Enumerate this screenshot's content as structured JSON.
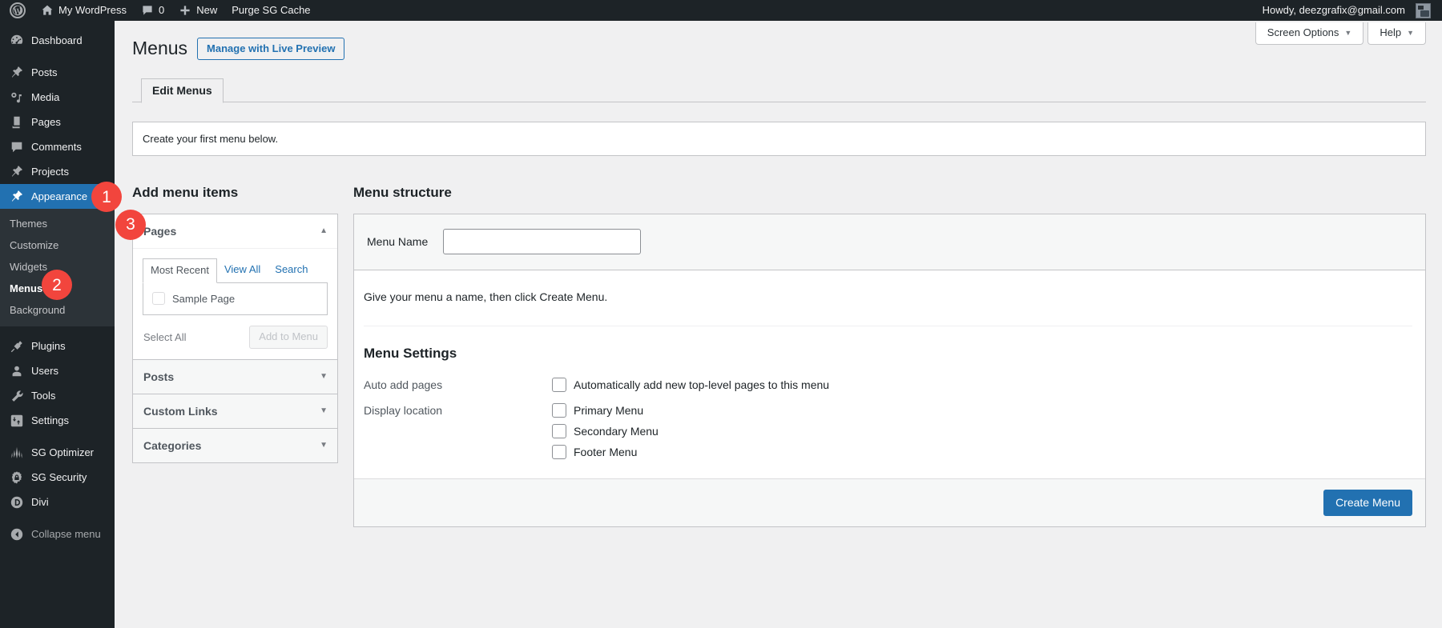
{
  "adminbar": {
    "logo_icon": "wordpress-logo-icon",
    "site_name": "My WordPress",
    "home_icon": "home-icon",
    "comments_icon": "comment-bubble-icon",
    "comment_count": "0",
    "new_icon": "plus-icon",
    "new_label": "New",
    "purge_label": "Purge SG Cache",
    "howdy": "Howdy, deezgrafix@gmail.com",
    "avatar_icon": "avatar-icon"
  },
  "sidebar": {
    "items": [
      {
        "label": "Dashboard",
        "icon": "dashboard-icon",
        "current": false
      },
      {
        "label": "Posts",
        "icon": "pin-icon",
        "current": false
      },
      {
        "label": "Media",
        "icon": "media-icon",
        "current": false
      },
      {
        "label": "Pages",
        "icon": "pages-icon",
        "current": false
      },
      {
        "label": "Comments",
        "icon": "comment-bubble-icon",
        "current": false
      },
      {
        "label": "Projects",
        "icon": "pin-icon",
        "current": false
      },
      {
        "label": "Appearance",
        "icon": "brush-icon",
        "current": true
      },
      {
        "label": "Plugins",
        "icon": "plug-icon",
        "current": false
      },
      {
        "label": "Users",
        "icon": "user-icon",
        "current": false
      },
      {
        "label": "Tools",
        "icon": "wrench-icon",
        "current": false
      },
      {
        "label": "Settings",
        "icon": "settings-sliders-icon",
        "current": false
      },
      {
        "label": "SG Optimizer",
        "icon": "sg-optimizer-icon",
        "current": false
      },
      {
        "label": "SG Security",
        "icon": "shield-gear-icon",
        "current": false
      },
      {
        "label": "Divi",
        "icon": "divi-icon",
        "current": false
      }
    ],
    "submenu": [
      {
        "label": "Themes",
        "current": false
      },
      {
        "label": "Customize",
        "current": false
      },
      {
        "label": "Widgets",
        "current": false
      },
      {
        "label": "Menus",
        "current": true
      },
      {
        "label": "Background",
        "current": false
      }
    ],
    "collapse": {
      "label": "Collapse menu",
      "icon": "collapse-arrow-icon"
    }
  },
  "badges": [
    {
      "number": "1",
      "target": "appearance"
    },
    {
      "number": "2",
      "target": "menus"
    },
    {
      "number": "3",
      "target": "menu-name"
    }
  ],
  "screen_meta": {
    "screen_options": "Screen Options",
    "help": "Help",
    "caret": "▼"
  },
  "page": {
    "title": "Menus",
    "live_preview_button": "Manage with Live Preview",
    "tab": "Edit Menus",
    "notice": "Create your first menu below."
  },
  "add_menu_items": {
    "heading": "Add menu items",
    "pages": {
      "title": "Pages",
      "tabs": [
        {
          "label": "Most Recent",
          "active": true
        },
        {
          "label": "View All",
          "active": false
        },
        {
          "label": "Search",
          "active": false
        }
      ],
      "items": [
        {
          "label": "Sample Page",
          "checked": false
        }
      ],
      "select_all": "Select All",
      "add_to_menu": "Add to Menu"
    },
    "accordions": [
      {
        "title": "Posts",
        "caret": "▼"
      },
      {
        "title": "Custom Links",
        "caret": "▼"
      },
      {
        "title": "Categories",
        "caret": "▼"
      }
    ]
  },
  "menu_structure": {
    "heading": "Menu structure",
    "menu_name_label": "Menu Name",
    "menu_name_value": "",
    "menu_name_placeholder": "",
    "hint": "Give your menu a name, then click Create Menu.",
    "settings_title": "Menu Settings",
    "auto_add_label": "Auto add pages",
    "auto_add_option": "Automatically add new top-level pages to this menu",
    "display_location_label": "Display location",
    "locations": [
      {
        "label": "Primary Menu",
        "checked": false
      },
      {
        "label": "Secondary Menu",
        "checked": false
      },
      {
        "label": "Footer Menu",
        "checked": false
      }
    ],
    "create_button": "Create Menu"
  },
  "colors": {
    "admin_dark": "#1d2327",
    "submenu_bg": "#2c3338",
    "accent_blue": "#2271b1",
    "badge_red": "#f2453d",
    "page_bg": "#f0f0f1"
  }
}
